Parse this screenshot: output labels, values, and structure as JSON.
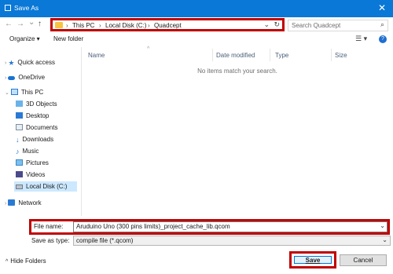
{
  "window": {
    "title": "Save As",
    "close_glyph": "✕"
  },
  "address": {
    "back_glyph": "←",
    "forward_glyph": "→",
    "recent_glyph": "⌄",
    "up_glyph": "↑",
    "crumbs": [
      "This PC",
      "Local Disk (C:)",
      "Quadcept"
    ],
    "separator": "›",
    "dropdown_glyph": "⌄",
    "refresh_glyph": "↻"
  },
  "search": {
    "placeholder": "Search Quadcept",
    "icon_glyph": "⌕"
  },
  "toolbar": {
    "organize": "Organize ▾",
    "new_folder": "New folder",
    "view_glyph": "☰ ▾",
    "help_glyph": "?"
  },
  "sidebar": {
    "items": [
      {
        "label": "Quick access"
      },
      {
        "label": "OneDrive"
      },
      {
        "label": "This PC"
      },
      {
        "label": "3D Objects"
      },
      {
        "label": "Desktop"
      },
      {
        "label": "Documents"
      },
      {
        "label": "Downloads"
      },
      {
        "label": "Music"
      },
      {
        "label": "Pictures"
      },
      {
        "label": "Videos"
      },
      {
        "label": "Local Disk (C:)"
      },
      {
        "label": "Network"
      }
    ],
    "selected": "Local Disk (C:)"
  },
  "columns": {
    "name": "Name",
    "date": "Date modified",
    "type": "Type",
    "size": "Size",
    "sort_glyph": "^"
  },
  "empty_message": "No items match your search.",
  "form": {
    "file_name_label": "File name:",
    "file_name_value": "Aruduino Uno (300 pins limits)_project_cache_lib.qcom",
    "save_type_label": "Save as type:",
    "save_type_value": "compile file (*.qcom)",
    "dropdown_glyph": "⌄"
  },
  "footer": {
    "hide_folders": "Hide Folders",
    "save": "Save",
    "cancel": "Cancel"
  },
  "colors": {
    "titlebar": "#0a78d6",
    "highlight": "#c00000",
    "selected_bg": "#cce8ff"
  }
}
